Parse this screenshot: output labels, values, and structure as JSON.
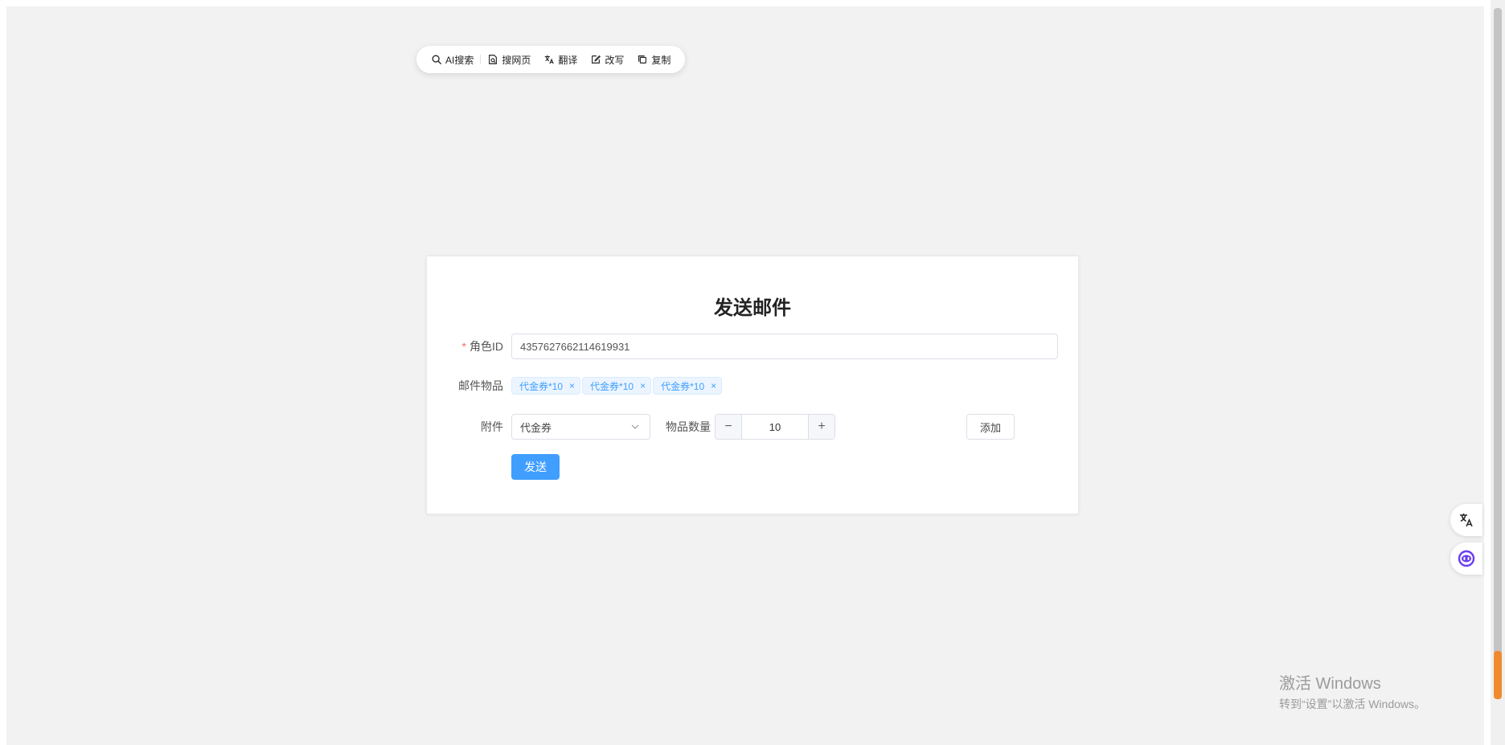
{
  "toolbar": {
    "items": [
      {
        "label": "AI搜索",
        "icon": "search-icon"
      },
      {
        "label": "搜网页",
        "icon": "web-search-icon"
      },
      {
        "label": "翻译",
        "icon": "translate-icon"
      },
      {
        "label": "改写",
        "icon": "edit-icon"
      },
      {
        "label": "复制",
        "icon": "copy-icon"
      }
    ]
  },
  "form": {
    "title": "发送邮件",
    "role_id": {
      "label": "角色ID",
      "required_mark": "*",
      "value": "4357627662114619931"
    },
    "items": {
      "label": "邮件物品",
      "tags": [
        "代金券*10",
        "代金券*10",
        "代金券*10"
      ],
      "close_glyph": "×"
    },
    "attachment": {
      "label": "附件",
      "selected": "代金券"
    },
    "quantity": {
      "label": "物品数量",
      "value": "10",
      "minus": "−",
      "plus": "+"
    },
    "add_label": "添加",
    "send_label": "发送"
  },
  "colors": {
    "primary": "#409eff",
    "tag_bg": "#ecf5ff",
    "required": "#f56c6c",
    "page_bg": "#f2f2f2"
  },
  "watermark": {
    "line1": "激活 Windows",
    "line2": "转到“设置”以激活 Windows。"
  }
}
